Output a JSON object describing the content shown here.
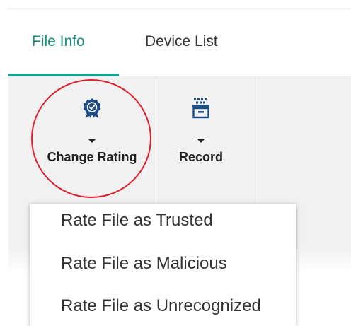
{
  "tabs": [
    {
      "label": "File Info",
      "active": true
    },
    {
      "label": "Device List",
      "active": false
    }
  ],
  "toolbar": {
    "change_rating": {
      "label": "Change Rating",
      "icon": "award-badge-icon"
    },
    "record": {
      "label": "Record",
      "icon": "record-archive-icon"
    }
  },
  "menu": {
    "items": [
      {
        "label": "Rate File as Trusted"
      },
      {
        "label": "Rate File as Malicious"
      },
      {
        "label": "Rate File as Unrecognized"
      }
    ]
  },
  "colors": {
    "accent": "#1aa38f",
    "highlight": "#e0202a",
    "icon": "#1f4e87"
  }
}
